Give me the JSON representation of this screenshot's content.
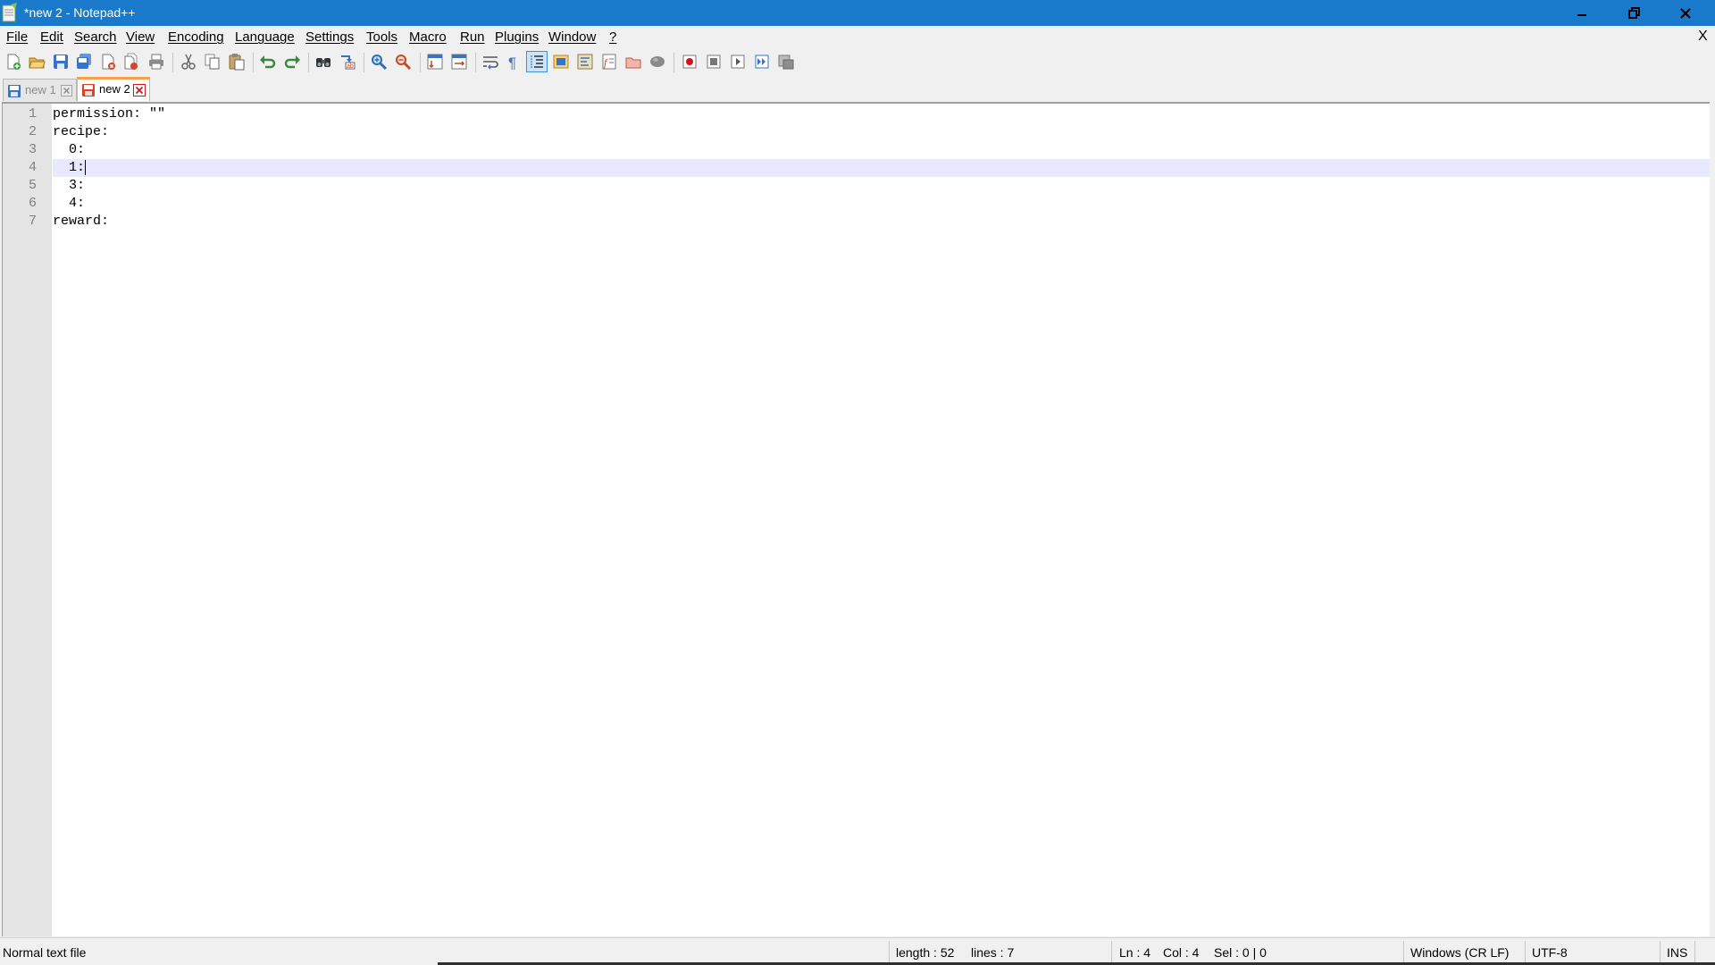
{
  "window": {
    "title": "*new 2 - Notepad++",
    "controls": {
      "minimize": "minimize-icon",
      "maximize": "restore-icon",
      "close": "close-icon"
    },
    "title_bar_color": "#1979ca"
  },
  "menu": {
    "items": [
      "File",
      "Edit",
      "Search",
      "View",
      "Encoding",
      "Language",
      "Settings",
      "Tools",
      "Macro",
      "Run",
      "Plugins",
      "Window",
      "?"
    ],
    "close_doc": "X"
  },
  "toolbar": {
    "buttons": [
      "new-file-icon",
      "open-file-icon",
      "save-icon",
      "save-all-icon",
      "close-icon",
      "close-all-icon",
      "print-icon",
      "cut-icon",
      "copy-icon",
      "paste-icon",
      "undo-icon",
      "redo-icon",
      "find-icon",
      "replace-icon",
      "zoom-in-icon",
      "zoom-out-icon",
      "sync-vertical-icon",
      "sync-horizontal-icon",
      "word-wrap-icon",
      "show-all-characters-icon",
      "indent-guide-icon",
      "user-defined-language-icon",
      "document-map-icon",
      "function-list-icon",
      "folder-as-workspace-icon",
      "monitoring-icon",
      "record-macro-icon",
      "stop-macro-icon",
      "play-macro-icon",
      "run-macro-multiple-icon",
      "save-macro-icon"
    ]
  },
  "tabs": [
    {
      "label": "new 1",
      "active": false,
      "icon": "saved-file-icon"
    },
    {
      "label": "new 2",
      "active": true,
      "icon": "unsaved-file-icon"
    }
  ],
  "editor": {
    "lines": [
      {
        "num": "1",
        "text": "permission: \"\""
      },
      {
        "num": "2",
        "text": "recipe:"
      },
      {
        "num": "3",
        "text": "  0:"
      },
      {
        "num": "4",
        "text": "  1:"
      },
      {
        "num": "5",
        "text": "  3:"
      },
      {
        "num": "6",
        "text": "  4:"
      },
      {
        "num": "7",
        "text": "reward:"
      }
    ],
    "current_line": 4,
    "current_line_color": "#e8e8ff"
  },
  "status": {
    "file_type": "Normal text file",
    "length": "length : 52",
    "lines": "lines : 7",
    "ln": "Ln : 4",
    "col": "Col : 4",
    "sel": "Sel : 0 | 0",
    "eol": "Windows (CR LF)",
    "encoding": "UTF-8",
    "mode": "INS"
  }
}
